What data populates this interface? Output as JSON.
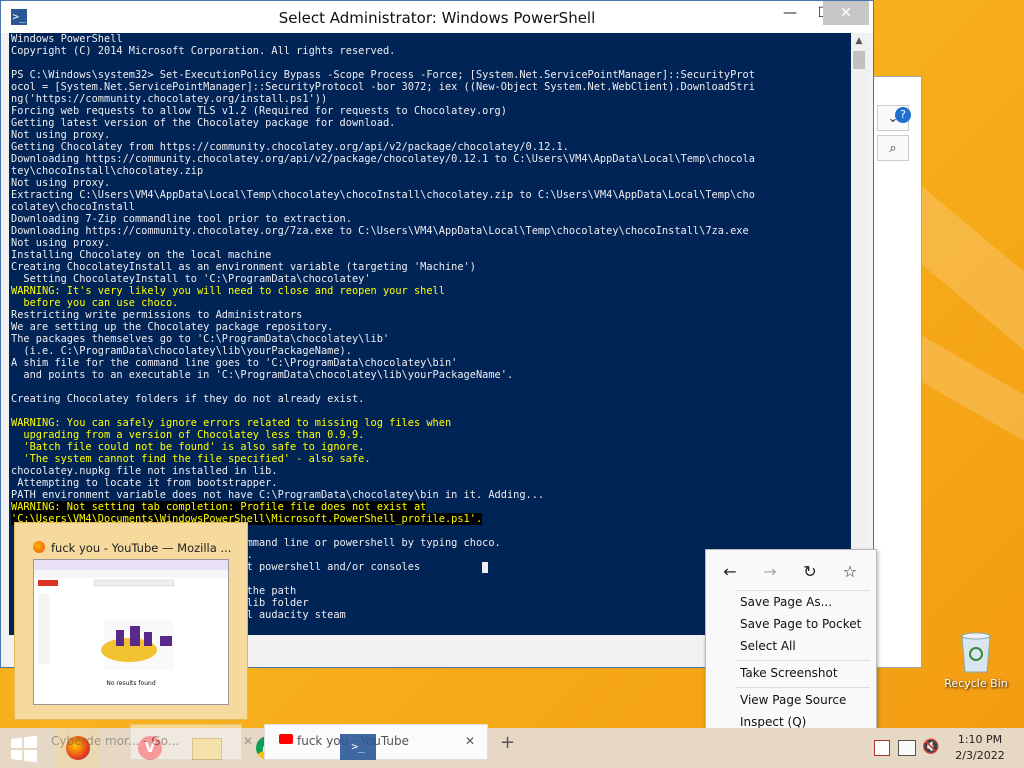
{
  "window": {
    "title": "Select Administrator: Windows PowerShell",
    "minimize": "—",
    "maximize": "☐",
    "close": "✕"
  },
  "console_lines": [
    {
      "text": "Windows PowerShell",
      "style": ""
    },
    {
      "text": "Copyright (C) 2014 Microsoft Corporation. All rights reserved.",
      "style": ""
    },
    {
      "text": "",
      "style": ""
    },
    {
      "text": "PS C:\\Windows\\system32> Set-ExecutionPolicy Bypass -Scope Process -Force; [System.Net.ServicePointManager]::SecurityProt",
      "style": ""
    },
    {
      "text": "ocol = [System.Net.ServicePointManager]::SecurityProtocol -bor 3072; iex ((New-Object System.Net.WebClient).DownloadStri",
      "style": ""
    },
    {
      "text": "ng('https://community.chocolatey.org/install.ps1'))",
      "style": ""
    },
    {
      "text": "Forcing web requests to allow TLS v1.2 (Required for requests to Chocolatey.org)",
      "style": ""
    },
    {
      "text": "Getting latest version of the Chocolatey package for download.",
      "style": ""
    },
    {
      "text": "Not using proxy.",
      "style": ""
    },
    {
      "text": "Getting Chocolatey from https://community.chocolatey.org/api/v2/package/chocolatey/0.12.1.",
      "style": ""
    },
    {
      "text": "Downloading https://community.chocolatey.org/api/v2/package/chocolatey/0.12.1 to C:\\Users\\VM4\\AppData\\Local\\Temp\\chocola",
      "style": ""
    },
    {
      "text": "tey\\chocoInstall\\chocolatey.zip",
      "style": ""
    },
    {
      "text": "Not using proxy.",
      "style": ""
    },
    {
      "text": "Extracting C:\\Users\\VM4\\AppData\\Local\\Temp\\chocolatey\\chocoInstall\\chocolatey.zip to C:\\Users\\VM4\\AppData\\Local\\Temp\\cho",
      "style": ""
    },
    {
      "text": "colatey\\chocoInstall",
      "style": ""
    },
    {
      "text": "Downloading 7-Zip commandline tool prior to extraction.",
      "style": ""
    },
    {
      "text": "Downloading https://community.chocolatey.org/7za.exe to C:\\Users\\VM4\\AppData\\Local\\Temp\\chocolatey\\chocoInstall\\7za.exe",
      "style": ""
    },
    {
      "text": "Not using proxy.",
      "style": ""
    },
    {
      "text": "Installing Chocolatey on the local machine",
      "style": ""
    },
    {
      "text": "Creating ChocolateyInstall as an environment variable (targeting 'Machine')",
      "style": ""
    },
    {
      "text": "  Setting ChocolateyInstall to 'C:\\ProgramData\\chocolatey'",
      "style": ""
    },
    {
      "text": "WARNING: It's very likely you will need to close and reopen your shell",
      "style": "warn"
    },
    {
      "text": "  before you can use choco.",
      "style": "warn"
    },
    {
      "text": "Restricting write permissions to Administrators",
      "style": ""
    },
    {
      "text": "We are setting up the Chocolatey package repository.",
      "style": ""
    },
    {
      "text": "The packages themselves go to 'C:\\ProgramData\\chocolatey\\lib'",
      "style": ""
    },
    {
      "text": "  (i.e. C:\\ProgramData\\chocolatey\\lib\\yourPackageName).",
      "style": ""
    },
    {
      "text": "A shim file for the command line goes to 'C:\\ProgramData\\chocolatey\\bin'",
      "style": ""
    },
    {
      "text": "  and points to an executable in 'C:\\ProgramData\\chocolatey\\lib\\yourPackageName'.",
      "style": ""
    },
    {
      "text": "",
      "style": ""
    },
    {
      "text": "Creating Chocolatey folders if they do not already exist.",
      "style": ""
    },
    {
      "text": "",
      "style": ""
    },
    {
      "text": "WARNING: You can safely ignore errors related to missing log files when",
      "style": "warn"
    },
    {
      "text": "  upgrading from a version of Chocolatey less than 0.9.9.",
      "style": "warn"
    },
    {
      "text": "  'Batch file could not be found' is also safe to ignore.",
      "style": "warn"
    },
    {
      "text": "  'The system cannot find the file specified' - also safe.",
      "style": "warn"
    },
    {
      "text": "chocolatey.nupkg file not installed in lib.",
      "style": ""
    },
    {
      "text": " Attempting to locate it from bootstrapper.",
      "style": ""
    },
    {
      "text": "PATH environment variable does not have C:\\ProgramData\\chocolatey\\bin in it. Adding...",
      "style": ""
    },
    {
      "text": "WARNING: Not setting tab completion: Profile file does not exist at",
      "style": "warnbg"
    },
    {
      "text": "'C:\\Users\\VM4\\Documents\\WindowsPowerShell\\Microsoft.PowerShell_profile.ps1'.",
      "style": "warnbg"
    },
    {
      "text": "                                    y.",
      "style": ""
    },
    {
      "text": "                                    command line or powershell by typing choco.",
      "style": ""
    },
    {
      "text": "                                    ns.",
      "style": ""
    },
    {
      "text": "                                    art powershell and/or consoles",
      "style": "cursor"
    },
    {
      "text": "",
      "style": ""
    },
    {
      "text": "                                    n the path",
      "style": ""
    },
    {
      "text": "                                    e lib folder",
      "style": ""
    },
    {
      "text": "                                    all audacity steam",
      "style": ""
    }
  ],
  "thumbnail": {
    "title": "fuck you - YouTube — Mozilla ...",
    "no_results": "No results found"
  },
  "context_menu": {
    "back": "←",
    "forward": "→",
    "reload": "↻",
    "bookmark": "☆",
    "items": [
      "Save Page As...",
      "Save Page to Pocket",
      "Select All",
      "Take Screenshot",
      "View Page Source",
      "Inspect (Q)"
    ]
  },
  "taskbar": {
    "tab1_label": "Cyberde mor... - Go...",
    "tab2_label": "fuck you - YouTube",
    "tab_close": "✕",
    "new_tab": "+",
    "time": "1:10 PM",
    "date": "2/3/2022"
  },
  "desktop": {
    "recycle_bin": "Recycle Bin"
  },
  "colors": {
    "console_bg": "#012456",
    "warning": "#ffff00",
    "taskbar": "#e6d8c4"
  }
}
